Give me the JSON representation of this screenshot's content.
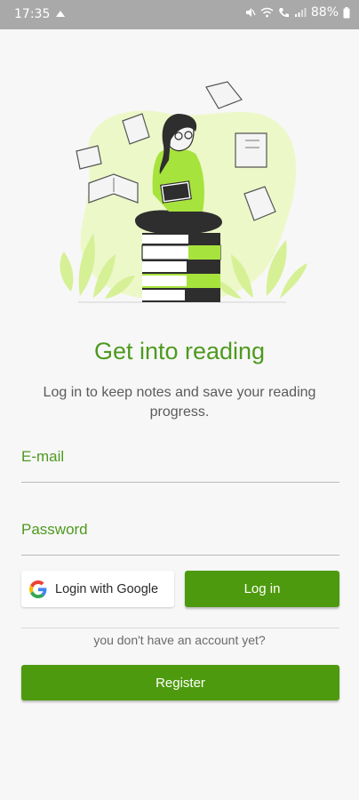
{
  "status_bar": {
    "time": "17:35",
    "battery": "88%"
  },
  "hero": {
    "title": "Get into reading",
    "subtitle": "Log in to keep notes and save your reading progress."
  },
  "form": {
    "email_label": "E-mail",
    "password_label": "Password"
  },
  "actions": {
    "google_label": "Login with Google",
    "login_label": "Log in",
    "no_account_text": "you don't have an account yet?",
    "register_label": "Register"
  },
  "colors": {
    "accent": "#4e9a1f",
    "button": "#4e9a0e",
    "illustration_blob": "#ecf8c8",
    "illustration_green": "#a7e33d"
  }
}
